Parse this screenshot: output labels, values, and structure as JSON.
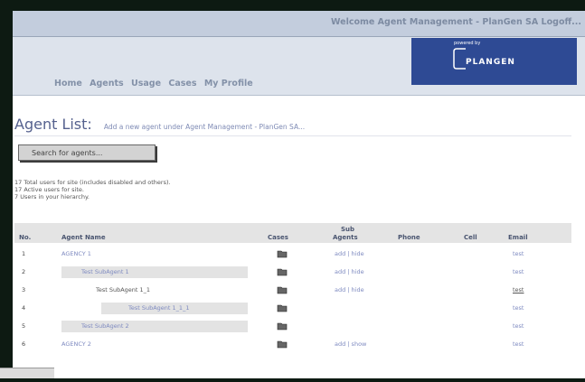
{
  "header": {
    "welcome_text": "Welcome Agent Management - PlanGen SA   Logoff..."
  },
  "nav": {
    "items": [
      "Home",
      "Agents",
      "Usage",
      "Cases",
      "My Profile"
    ]
  },
  "logo": {
    "powered_by": "powered by",
    "name": "PLANGEN"
  },
  "page": {
    "title": "Agent List:",
    "add_link": "Add a new agent under Agent Management - PlanGen SA..."
  },
  "search": {
    "label": "Search for agents..."
  },
  "stats": [
    "17 Total users for site (includes disabled and others).",
    "17 Active users for site.",
    "7 Users in your hierarchy."
  ],
  "table": {
    "headers": {
      "no": "No.",
      "agent": "Agent Name",
      "cases": "Cases",
      "sub1": "Sub",
      "sub2": "Agents",
      "phone": "Phone",
      "cell": "Cell",
      "email": "Email"
    },
    "rows": [
      {
        "no": "1",
        "agent": "AGENCY 1",
        "sub": "add | hide",
        "email": "test"
      },
      {
        "no": "2",
        "agent": "Test SubAgent 1",
        "sub": "add | hide",
        "email": "test"
      },
      {
        "no": "3",
        "agent": "Test SubAgent 1_1",
        "sub": "add | hide",
        "email": "test"
      },
      {
        "no": "4",
        "agent": "Test SubAgent 1_1_1",
        "sub": "",
        "email": "test"
      },
      {
        "no": "5",
        "agent": "Test SubAgent 2",
        "sub": "",
        "email": "test"
      },
      {
        "no": "6",
        "agent": "AGENCY 2",
        "sub": "add | show",
        "email": "test"
      }
    ]
  },
  "icons": {
    "case_icon": "folder-icon"
  }
}
